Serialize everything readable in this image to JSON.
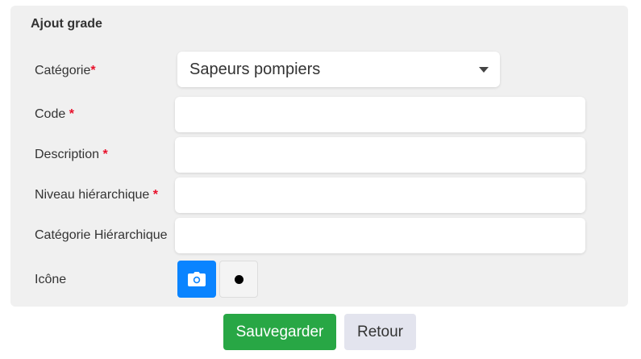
{
  "form": {
    "title": "Ajout grade",
    "required_mark": "*",
    "fields": [
      {
        "label": "Catégorie",
        "required": true,
        "type": "select",
        "value": "Sapeurs pompiers"
      },
      {
        "label": "Code",
        "required": true,
        "type": "text",
        "value": ""
      },
      {
        "label": "Description",
        "required": true,
        "type": "text",
        "value": ""
      },
      {
        "label": "Niveau hiérarchique",
        "required": true,
        "type": "text",
        "value": ""
      },
      {
        "label": "Catégorie Hiérarchique",
        "required": false,
        "type": "text",
        "value": ""
      },
      {
        "label": "Icône",
        "required": false,
        "type": "icon-picker"
      }
    ],
    "icon_options": [
      {
        "icon": "camera-icon",
        "selected": true,
        "color": "#0a84ff"
      },
      {
        "icon": "circle-dot-icon",
        "selected": false,
        "color": "#000000"
      }
    ]
  },
  "actions": {
    "save_label": "Sauvegarder",
    "back_label": "Retour",
    "save_color": "#28a745",
    "back_color": "#e3e4ee"
  },
  "colors": {
    "panel_bg": "#f0f0f0",
    "required": "#e8102a"
  }
}
